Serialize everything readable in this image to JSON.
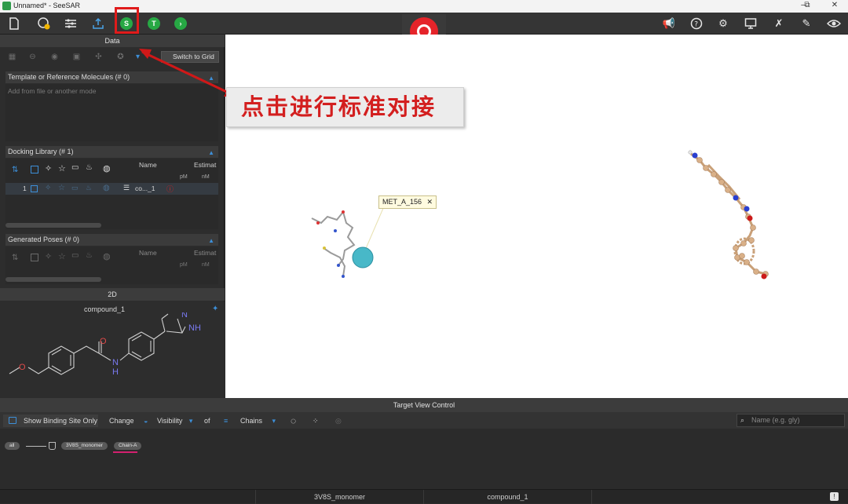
{
  "window": {
    "title": "Unnamed* - SeeSAR",
    "controls": [
      "–",
      "⧉",
      "✕"
    ]
  },
  "toolbar": {
    "left_icons": [
      "file-icon",
      "analyzer-mode-icon",
      "settings-sliders-icon",
      "upload-icon",
      "docking-mode-icon",
      "inspirator-mode-icon",
      "next-mode-icon"
    ],
    "docking_badge": "S",
    "inspirator_badge": "T",
    "right_icons": [
      "announce-icon",
      "help-icon",
      "gear-icon",
      "screen-icon",
      "tools-icon",
      "satellite-icon",
      "eye-icon"
    ]
  },
  "data_panel": {
    "title": "Data",
    "switch_grid_label": "Switch to Grid",
    "template_section": {
      "title": "Template or Reference Molecules (# 0)",
      "placeholder": "Add from file or another mode"
    },
    "docking_library": {
      "title": "Docking Library (# 1)",
      "col_name": "Name",
      "col_estimate": "Estimat",
      "unit_pm": "pM",
      "unit_nm": "nM",
      "rows": [
        {
          "index": "1",
          "name": "co..._1",
          "warn": "ⓘ"
        }
      ]
    },
    "generated_poses": {
      "title": "Generated Poses (# 0)",
      "col_name": "Name",
      "col_estimate": "Estimat",
      "unit_pm": "pM",
      "unit_nm": "nM"
    }
  },
  "panel_2d": {
    "title": "2D",
    "compound_name": "compound_1",
    "atoms": {
      "o_ether": "O",
      "o_carbonyl": "O",
      "n_amide": "N",
      "h_amide": "H",
      "n_pyrazole": "N",
      "nh_pyrazole": "NH"
    }
  },
  "view3d": {
    "callout_text": "点击进行标准对接",
    "residue_label": "MET_A_156",
    "residue_close": "✕"
  },
  "target_view_control": {
    "title": "Target View Control",
    "show_binding_site_only": "Show Binding Site Only",
    "change_label": "Change",
    "visibility_label": "Visibility",
    "of_label": "of",
    "chains_label": "Chains",
    "search_placeholder": "Name (e.g. gly)",
    "tree": {
      "all": "all",
      "structure": "3V8S_monomer",
      "chain": "Chain-A"
    }
  },
  "status_bar": {
    "protein": "3V8S_monomer",
    "ligand": "compound_1",
    "info_icon": "!"
  },
  "colors": {
    "accent_red": "#e01b1b",
    "logo_red": "#e5242a",
    "mode_green": "#27a844",
    "accent_blue": "#3d8fd8",
    "chain_underline": "#d4206f"
  }
}
